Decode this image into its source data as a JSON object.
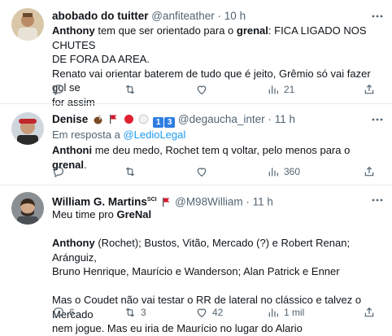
{
  "tweets": [
    {
      "name": "abobado do tuitter",
      "handle": "@anfiteather",
      "sep": "·",
      "time": "10 h",
      "lines": [
        {
          "bold": "Anthony",
          "rest": " tem que ser orientado para o "
        },
        {
          "bold": "grenal",
          "rest": ": FICA LIGADO NOS CHUTES"
        },
        {
          "line2": "DE FORA DA AREA."
        },
        {
          "line3": "Renato vai orientar baterem de tudo que é jeito, Grêmio só vai fazer gol se"
        },
        {
          "line4": "for assim"
        }
      ],
      "views": "21"
    },
    {
      "name": "Denise",
      "handle": "@degaucha_inter",
      "sep": "·",
      "time": "11 h",
      "badges": [
        "1",
        "3"
      ],
      "reply_prefix": "Em resposta a ",
      "reply_handle": "@LedioLegal",
      "text_bold1": "Anthoni",
      "text_mid": "  me deu medo, Rochet tem q voltar, pelo menos para o ",
      "text_bold2": "grenal",
      "text_end": ".",
      "views": "360"
    },
    {
      "name": "William G. Martins",
      "name_sup": "SCI",
      "handle": "@M98William",
      "sep": "·",
      "time": "11 h",
      "p1_prefix": "Meu time pro ",
      "p1_bold": "GreNal",
      "p2_bold": "Anthony",
      "p2_rest1": " (Rochet); Bustos, Vitão, Mercado (?) e Robert Renan; Aránguiz,",
      "p2_rest2": "Bruno Henrique, Maurício e Wanderson; Alan Patrick e Enner",
      "p3_line1": "Mas o Coudet não vai testar o RR de lateral no clássico e talvez o Mercado",
      "p3_line2": "nem jogue. Mas eu iria de Maurício no lugar do Alario",
      "replies": "6",
      "retweets": "3",
      "likes": "42",
      "views": "1 mil"
    }
  ]
}
